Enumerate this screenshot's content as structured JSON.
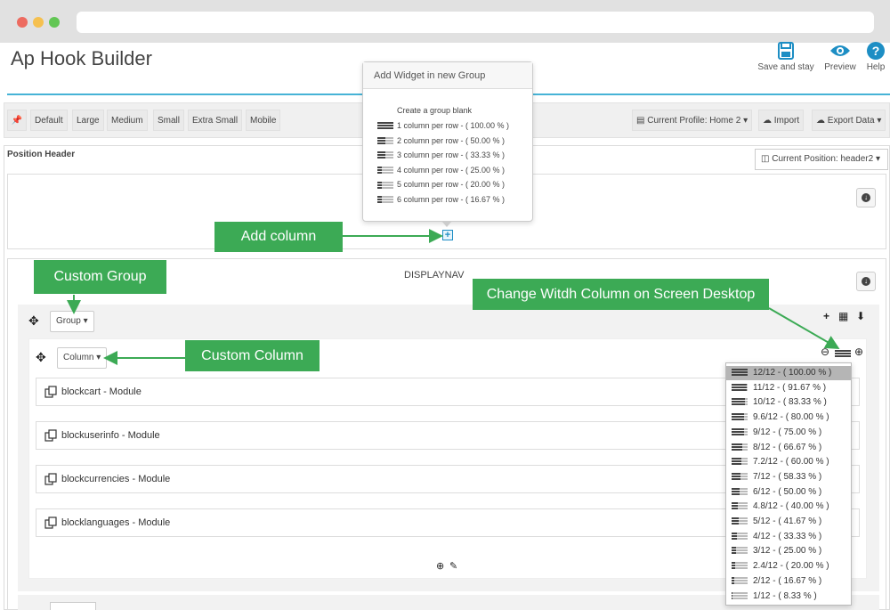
{
  "app": {
    "title": "Ap Hook Builder"
  },
  "toolbar_actions": [
    {
      "label": "Save and stay",
      "icon": "save-icon"
    },
    {
      "label": "Preview",
      "icon": "eye-icon"
    },
    {
      "label": "Help",
      "icon": "help-icon"
    }
  ],
  "screen_sizes": [
    "Default",
    "Large",
    "Medium",
    "Small",
    "Extra Small",
    "Mobile"
  ],
  "profile": {
    "current": "Current Profile: Home 2",
    "import_label": "Import",
    "export_label": "Export Data"
  },
  "position": {
    "label": "Position Header",
    "current": "Current Position: header2"
  },
  "section": {
    "name": "DISPLAYNAV"
  },
  "group_button": "Group",
  "column_button": "Column",
  "modules": [
    "blockcart - Module",
    "blockuserinfo - Module",
    "blockcurrencies - Module",
    "blocklanguages - Module"
  ],
  "popover": {
    "title": "Add Widget in new Group",
    "blank_label": "Create a group blank",
    "items": [
      {
        "label": "1 column per row - ( 100.00 % )",
        "filled": 4
      },
      {
        "label": "2 column per row - ( 50.00 % )",
        "filled": 2
      },
      {
        "label": "3 column per row - ( 33.33 % )",
        "filled": 2
      },
      {
        "label": "4 column per row - ( 25.00 % )",
        "filled": 1
      },
      {
        "label": "5 column per row - ( 20.00 % )",
        "filled": 1
      },
      {
        "label": "6 column per row - ( 16.67 % )",
        "filled": 1
      }
    ]
  },
  "width_options": [
    {
      "label": "12/12 - ( 100.00 % )",
      "fraction": 1.0,
      "selected": true
    },
    {
      "label": "11/12 - ( 91.67 % )",
      "fraction": 0.9167
    },
    {
      "label": "10/12 - ( 83.33 % )",
      "fraction": 0.8333
    },
    {
      "label": "9.6/12 - ( 80.00 % )",
      "fraction": 0.8
    },
    {
      "label": "9/12 - ( 75.00 % )",
      "fraction": 0.75
    },
    {
      "label": "8/12 - ( 66.67 % )",
      "fraction": 0.6667
    },
    {
      "label": "7.2/12 - ( 60.00 % )",
      "fraction": 0.6
    },
    {
      "label": "7/12 - ( 58.33 % )",
      "fraction": 0.5833
    },
    {
      "label": "6/12 - ( 50.00 % )",
      "fraction": 0.5
    },
    {
      "label": "4.8/12 - ( 40.00 % )",
      "fraction": 0.4
    },
    {
      "label": "5/12 - ( 41.67 % )",
      "fraction": 0.4167
    },
    {
      "label": "4/12 - ( 33.33 % )",
      "fraction": 0.3333
    },
    {
      "label": "3/12 - ( 25.00 % )",
      "fraction": 0.25
    },
    {
      "label": "2.4/12 - ( 20.00 % )",
      "fraction": 0.2
    },
    {
      "label": "2/12 - ( 16.67 % )",
      "fraction": 0.1667
    },
    {
      "label": "1/12 - ( 8.33 % )",
      "fraction": 0.0833
    }
  ],
  "annotations": {
    "add_column": "Add column",
    "custom_group": "Custom Group",
    "custom_column": "Custom Column",
    "change_width": "Change Witdh Column on Screen Desktop"
  },
  "colors": {
    "accent_blue": "#46b3d6",
    "annotation_green": "#3caa55",
    "window_red": "#ed6b60",
    "window_yellow": "#f5c04f",
    "window_green": "#62c654"
  }
}
